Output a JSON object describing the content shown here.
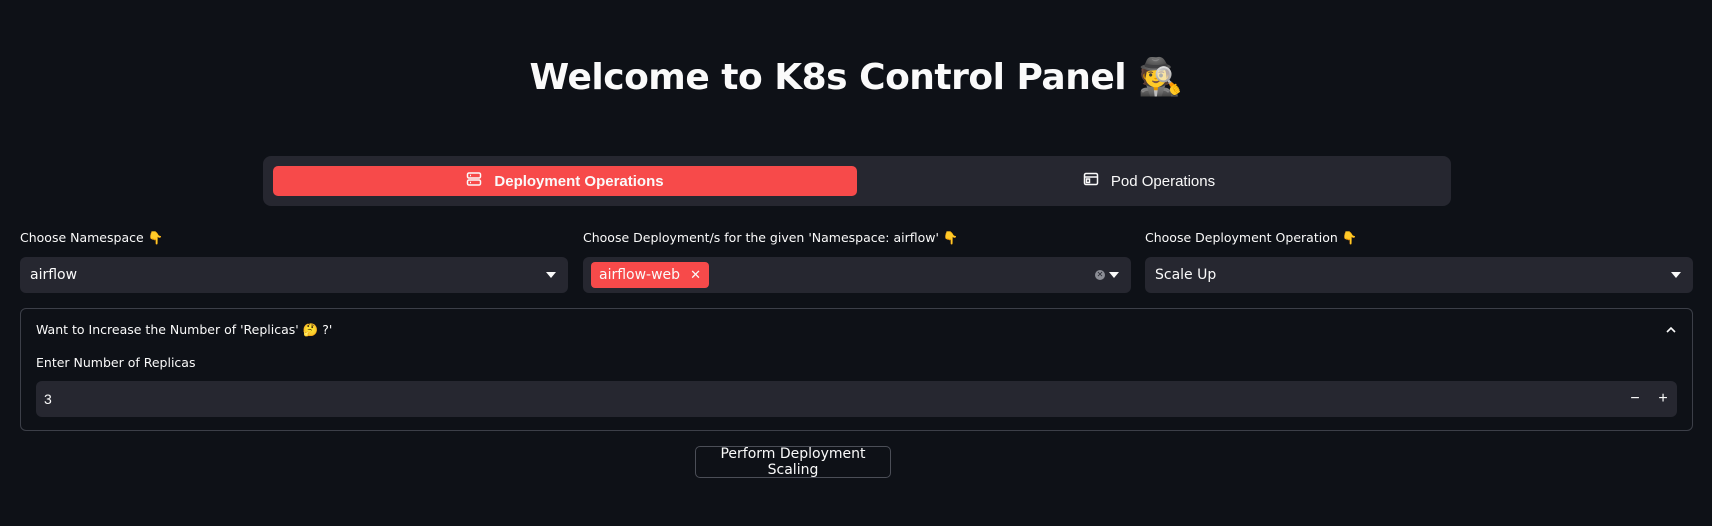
{
  "page": {
    "title": "Welcome to K8s Control Panel 🕵️"
  },
  "tabs": [
    {
      "label": "Deployment Operations",
      "icon": "server-icon",
      "active": true
    },
    {
      "label": "Pod Operations",
      "icon": "window-icon",
      "active": false
    }
  ],
  "namespace": {
    "label": "Choose Namespace 👇",
    "value": "airflow"
  },
  "deployments": {
    "label": "Choose Deployment/s for the given 'Namespace: airflow' 👇",
    "selected": [
      "airflow-web"
    ]
  },
  "operation": {
    "label": "Choose Deployment Operation 👇",
    "value": "Scale Up"
  },
  "expander": {
    "title": "Want to Increase the Number of 'Replicas' 🤔 ?'",
    "replicas_label": "Enter Number of Replicas",
    "replicas_value": "3",
    "minus": "−",
    "plus": "+"
  },
  "action": {
    "label": "Perform Deployment Scaling"
  },
  "colors": {
    "background": "#0e1117",
    "surface": "#262730",
    "accent": "#f74a4a"
  }
}
